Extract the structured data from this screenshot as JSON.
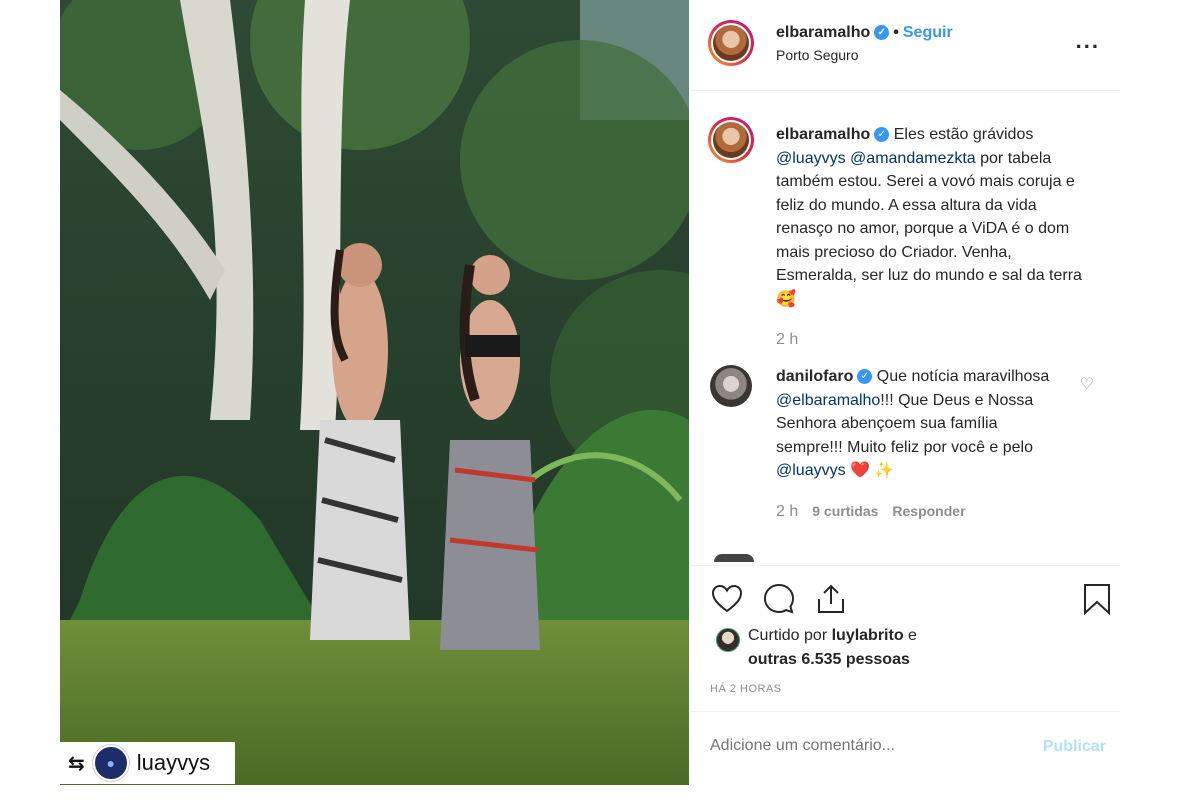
{
  "post": {
    "username": "elbaramalho",
    "verified_mark": "✓",
    "separator": "•",
    "follow_label": "Seguir",
    "location": "Porto Seguro",
    "more_label": "..."
  },
  "caption": {
    "username": "elbaramalho",
    "text_before": " Eles estão grávidos ",
    "mention1": "@luayvys",
    "mention2": "@amandamezkta",
    "text_after": " por tabela também estou. Serei a vovó mais coruja e feliz do mundo. A essa altura da vida renasço no amor, porque a ViDA é o dom mais precioso do Criador. Venha, Esmeralda, ser luz do mundo e sal da terra",
    "emoji": "🥰",
    "time": "2 h"
  },
  "comment": {
    "username": "danilofaro",
    "text_before": " Que notícia maravilhosa ",
    "mention1": "@elbaramalho",
    "text_mid": "!!! Que Deus e Nossa Senhora abençoem sua família sempre!!! Muito feliz por você e pelo ",
    "mention2": "@luayvys",
    "emoji": " ❤️ ✨",
    "time": "2 h",
    "likes": "9 curtidas",
    "reply_label": "Responder"
  },
  "likes": {
    "prefix": "Curtido por ",
    "user": "luylabrito",
    "connector": " e",
    "others": "outras 6.535 pessoas"
  },
  "timestamp": "HÁ 2 HORAS",
  "comment_input": {
    "placeholder": "Adicione um comentário..."
  },
  "publish_label": "Publicar",
  "repost": {
    "icon": "⇆",
    "username": "luayvys"
  },
  "colors": {
    "link": "#3897f0",
    "mention": "#003569",
    "muted": "#8e8e8e",
    "publish_disabled": "#b2dffc"
  },
  "icons": [
    "heart-icon",
    "comment-icon",
    "share-icon",
    "bookmark-icon",
    "more-icon",
    "verified-icon",
    "repost-icon"
  ]
}
